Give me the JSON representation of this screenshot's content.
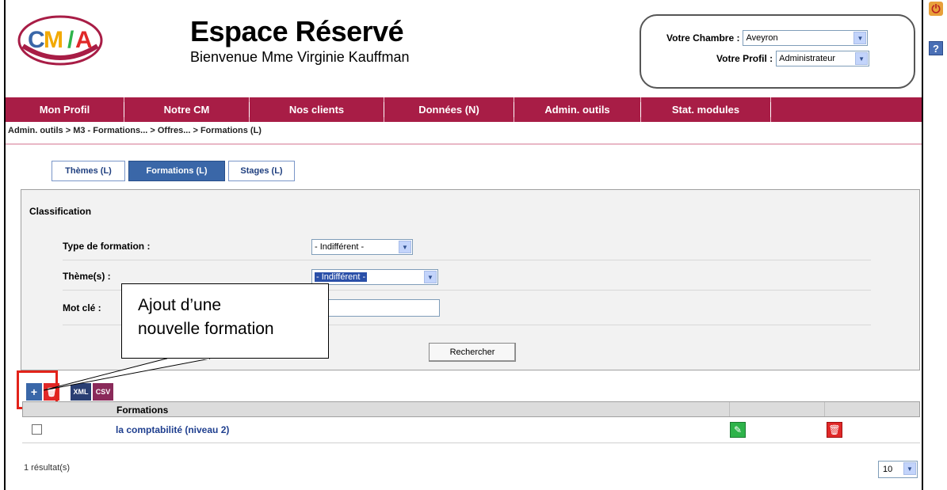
{
  "header": {
    "title": "Espace Réservé",
    "welcome": "Bienvenue  Mme Virginie Kauffman",
    "chambre_label": "Votre Chambre :",
    "chambre_value": "Aveyron",
    "profil_label": "Votre Profil :",
    "profil_value": "Administrateur",
    "power_icon": "power-icon",
    "help_icon": "?"
  },
  "nav": {
    "items": [
      "Mon Profil",
      "Notre CM",
      "Nos clients",
      "Données (N)",
      "Admin. outils",
      "Stat. modules"
    ],
    "color": "#a81d46"
  },
  "breadcrumb": "Admin. outils > M3 - Formations... > Offres... > Formations (L)",
  "tabs": [
    "Thèmes (L)",
    "Formations (L)",
    "Stages (L)"
  ],
  "classification": {
    "title": "Classification",
    "type_label": "Type de formation :",
    "type_value": "- Indifférent -",
    "theme_label": "Thème(s) :",
    "theme_value": "- Indifférent -",
    "keyword_label": "Mot clé :",
    "search_button": "Rechercher"
  },
  "toolbar": {
    "xml_label": "XML",
    "csv_label": "CSV",
    "add_label": "+"
  },
  "callout": {
    "line1": "Ajout d’une",
    "line2": "nouvelle formation"
  },
  "table": {
    "column_header": "Formations",
    "rows": [
      {
        "label": "la comptabilité (niveau 2)"
      }
    ]
  },
  "footer": {
    "results": "1 résultat(s)",
    "per_page": "10"
  }
}
